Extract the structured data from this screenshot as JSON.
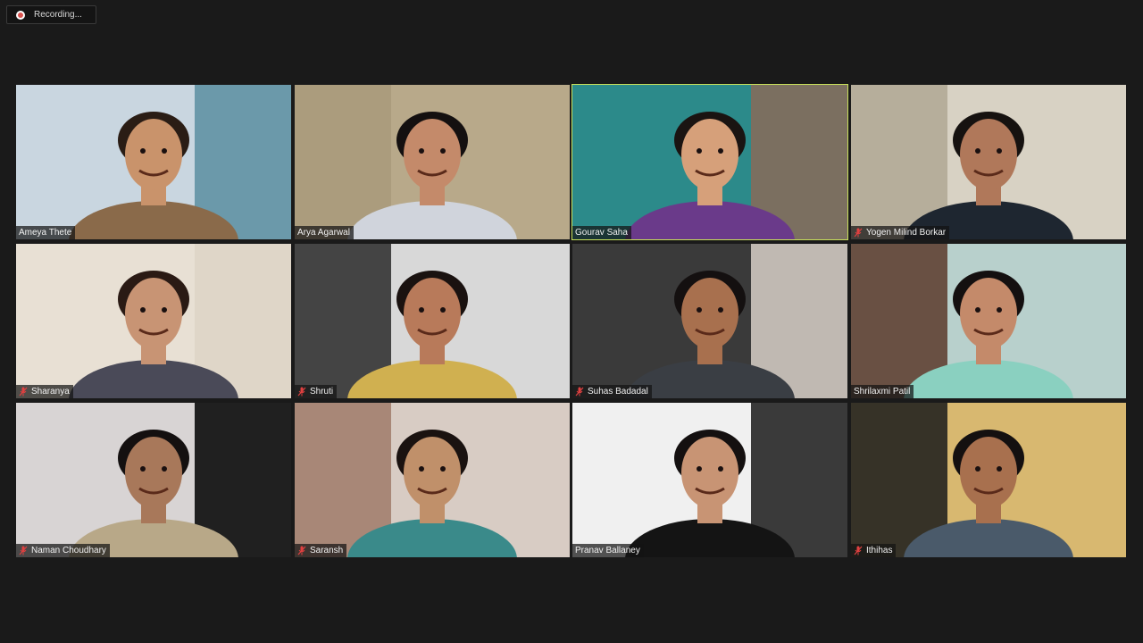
{
  "recording": {
    "label": "Recording...",
    "indicator_icon": "record-icon",
    "indicator_color": "#d9534f"
  },
  "active_speaker_color": "#c8e05a",
  "participants": [
    {
      "name": "Ameya Thete",
      "muted": false,
      "active": false,
      "bg": "#c9d6e0",
      "wall": "#5b8ea0",
      "shirt": "#8a6a4a",
      "skin": "#c9936b",
      "hair": "#2a1d15"
    },
    {
      "name": "Arya Agarwal",
      "muted": false,
      "active": false,
      "bg": "#b8a98a",
      "wall": "#a89a7a",
      "shirt": "#d0d4dc",
      "skin": "#c48a6a",
      "hair": "#141010"
    },
    {
      "name": "Gourav Saha",
      "muted": false,
      "active": true,
      "bg": "#2c8a8a",
      "wall": "#8a6a58",
      "shirt": "#6a3a8a",
      "skin": "#d6a07a",
      "hair": "#1a1412"
    },
    {
      "name": "Yogen Milind Borkar",
      "muted": true,
      "active": false,
      "bg": "#d8d2c4",
      "wall": "#b0a894",
      "shirt": "#1e2630",
      "skin": "#b0785a",
      "hair": "#161210"
    },
    {
      "name": "Sharanya",
      "muted": true,
      "active": false,
      "bg": "#e8e0d4",
      "wall": "#ddd4c6",
      "shirt": "#4a4a58",
      "skin": "#c89474",
      "hair": "#2a1a14"
    },
    {
      "name": "Shruti",
      "muted": true,
      "active": false,
      "bg": "#d8d8d8",
      "wall": "#2a2a2a",
      "shirt": "#d0b050",
      "skin": "#b87a5a",
      "hair": "#1a1210"
    },
    {
      "name": "Suhas Badadal",
      "muted": true,
      "active": false,
      "bg": "#3a3a3a",
      "wall": "#d8d0c8",
      "shirt": "#3a3e44",
      "skin": "#a8704e",
      "hair": "#141010"
    },
    {
      "name": "Shrilaxmi Patil",
      "muted": false,
      "active": false,
      "bg": "#b8d0cc",
      "wall": "#5a3a2a",
      "shirt": "#8ad0c0",
      "skin": "#c48a6a",
      "hair": "#141010"
    },
    {
      "name": "Naman Choudhary",
      "muted": true,
      "active": false,
      "bg": "#d8d4d4",
      "wall": "#000000",
      "shirt": "#b8a888",
      "skin": "#a8785a",
      "hair": "#141010"
    },
    {
      "name": "Saransh",
      "muted": true,
      "active": false,
      "bg": "#d8ccc4",
      "wall": "#a07a6a",
      "shirt": "#3a8a8a",
      "skin": "#c0906a",
      "hair": "#1a1210"
    },
    {
      "name": "Pranav Ballaney",
      "muted": false,
      "active": false,
      "bg": "#f0f0f0",
      "wall": "#1a1a1a",
      "shirt": "#141414",
      "skin": "#c89474",
      "hair": "#141010"
    },
    {
      "name": "Ithihas",
      "muted": true,
      "active": false,
      "bg": "#d8b870",
      "wall": "#1a1a1a",
      "shirt": "#4a5a6a",
      "skin": "#a8704e",
      "hair": "#141010"
    }
  ]
}
